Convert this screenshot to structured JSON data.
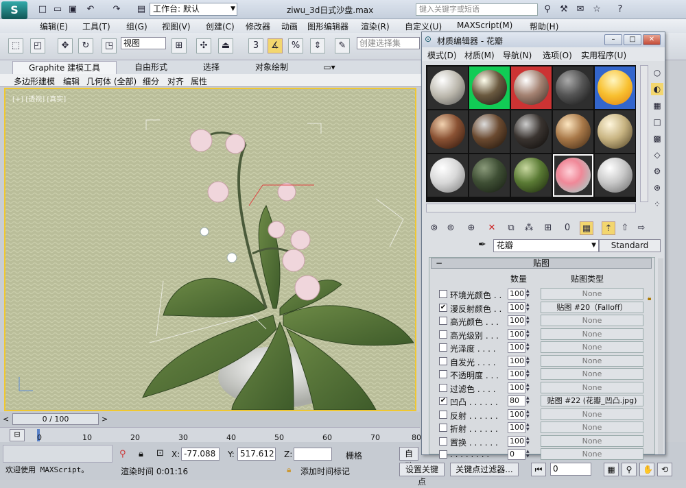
{
  "title": {
    "workspace_label": "工作台: 默认",
    "file_title": "ziwu_3d日式沙盘.max",
    "search_placeholder": "键入关键字或短语"
  },
  "menu": [
    "编辑(E)",
    "工具(T)",
    "组(G)",
    "视图(V)",
    "创建(C)",
    "修改器",
    "动画",
    "图形编辑器",
    "渲染(R)",
    "自定义(U)",
    "MAXScript(M)",
    "帮助(H)"
  ],
  "toolbar": {
    "view_combo": "视图",
    "selection_set_placeholder": "创建选择集"
  },
  "ribbon": {
    "tabs": [
      "Graphite 建模工具",
      "自由形式",
      "选择",
      "对象绘制"
    ],
    "subtabs": [
      "多边形建模",
      "编辑",
      "几何体 (全部)",
      "细分",
      "对齐",
      "属性"
    ]
  },
  "viewport": {
    "label": "[+] [透视] [真实]"
  },
  "timeline": {
    "slider": "0 / 100",
    "ticks": [
      "0",
      "10",
      "20",
      "30",
      "40",
      "50",
      "60",
      "70",
      "80"
    ]
  },
  "status": {
    "welcome": "欢迎使用 MAXScript。",
    "render_time": "渲染时间 0:01:16",
    "x_label": "X:",
    "x_value": "-77.088",
    "y_label": "Y:",
    "y_value": "517.612",
    "z_label": "Z:",
    "grid_label": "栅格",
    "auto_key": "自动",
    "add_time_tag": "添加时间标记",
    "set_key": "设置关键点",
    "key_filters": "关键点过滤器...",
    "frame_value": "0"
  },
  "material_editor": {
    "title": "材质编辑器 - 花瓣",
    "menu": [
      "模式(D)",
      "材质(M)",
      "导航(N)",
      "选项(O)",
      "实用程序(U)"
    ],
    "material_name": "花瓣",
    "material_type": "Standard",
    "rollout_title": "贴图",
    "col_amount": "数量",
    "col_maptype": "贴图类型",
    "maps": [
      {
        "label": "环境光颜色 . .",
        "checked": false,
        "amount": "100",
        "map": "None"
      },
      {
        "label": "漫反射颜色 . .",
        "checked": true,
        "amount": "100",
        "map": "贴图 #20（Falloff）"
      },
      {
        "label": "高光颜色 . . .",
        "checked": false,
        "amount": "100",
        "map": "None"
      },
      {
        "label": "高光级别 . . .",
        "checked": false,
        "amount": "100",
        "map": "None"
      },
      {
        "label": "光泽度 . . . .",
        "checked": false,
        "amount": "100",
        "map": "None"
      },
      {
        "label": "自发光 . . . .",
        "checked": false,
        "amount": "100",
        "map": "None"
      },
      {
        "label": "不透明度 . . .",
        "checked": false,
        "amount": "100",
        "map": "None"
      },
      {
        "label": "过滤色 . . . .",
        "checked": false,
        "amount": "100",
        "map": "None"
      },
      {
        "label": "凹凸 . . . . . .",
        "checked": true,
        "amount": "80",
        "map": "贴图 #22 (花瓣_凹凸.jpg)"
      },
      {
        "label": "反射 . . . . . .",
        "checked": false,
        "amount": "100",
        "map": "None"
      },
      {
        "label": "折射 . . . . . .",
        "checked": false,
        "amount": "100",
        "map": "None"
      },
      {
        "label": "置换 . . . . . .",
        "checked": false,
        "amount": "100",
        "map": "None"
      },
      {
        "label": ". . . . . . . .",
        "checked": false,
        "amount": "0",
        "map": "None"
      }
    ]
  }
}
